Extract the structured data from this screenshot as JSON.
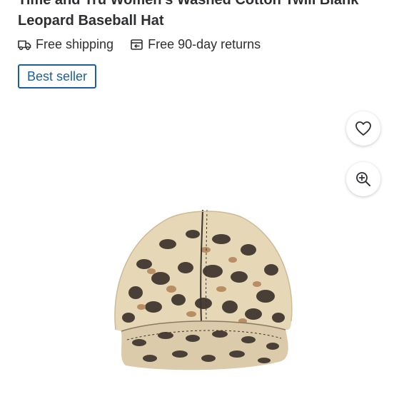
{
  "product": {
    "title": "Time and Tru Women's Washed Cotton Twill Blank Leopard Baseball Hat"
  },
  "perks": [
    {
      "label": "Free shipping",
      "icon": "truck-icon"
    },
    {
      "label": "Free 90-day returns",
      "icon": "return-icon"
    }
  ],
  "badge": {
    "label": "Best seller",
    "color": "#1c5f9e"
  },
  "actions": {
    "favorite_icon": "heart-icon",
    "zoom_icon": "zoom-in-icon"
  },
  "image": {
    "subject": "leopard-print-baseball-hat"
  }
}
